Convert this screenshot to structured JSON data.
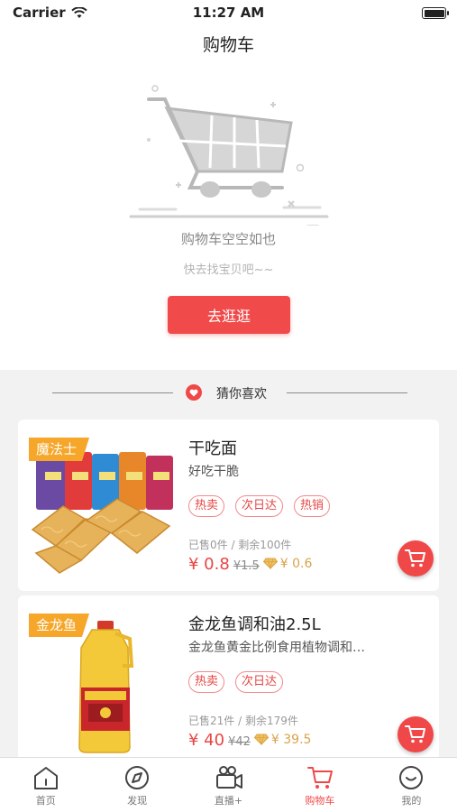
{
  "status_bar": {
    "carrier": "Carrier",
    "time": "11:27 AM"
  },
  "header": {
    "title": "购物车"
  },
  "empty": {
    "title": "购物车空空如也",
    "subtitle": "快去找宝贝吧~~",
    "button": "去逛逛"
  },
  "guess": {
    "label": "猜你喜欢"
  },
  "products": [
    {
      "tag": "魔法士",
      "name": "干吃面",
      "desc": "好吃干脆",
      "badges": [
        "热卖",
        "次日达",
        "热销"
      ],
      "sold": "已售0件 / 剩余100件",
      "price": "¥ 0.8",
      "original_price": "¥1.5",
      "vip_price": "¥ 0.6"
    },
    {
      "tag": "金龙鱼",
      "name": "金龙鱼调和油2.5L",
      "desc": "金龙鱼黄金比例食用植物调和…",
      "badges": [
        "热卖",
        "次日达"
      ],
      "sold": "已售21件 / 剩余179件",
      "price": "¥ 40",
      "original_price": "¥42",
      "vip_price": "¥ 39.5"
    }
  ],
  "tabs": [
    {
      "label": "首页",
      "icon": "home-icon",
      "active": false
    },
    {
      "label": "发现",
      "icon": "compass-icon",
      "active": false
    },
    {
      "label": "直播+",
      "icon": "camera-icon",
      "active": false
    },
    {
      "label": "购物车",
      "icon": "cart-icon",
      "active": true
    },
    {
      "label": "我的",
      "icon": "smiley-icon",
      "active": false
    }
  ],
  "colors": {
    "accent": "#f04848",
    "tag": "#f6a629",
    "vip": "#d9a34a"
  }
}
